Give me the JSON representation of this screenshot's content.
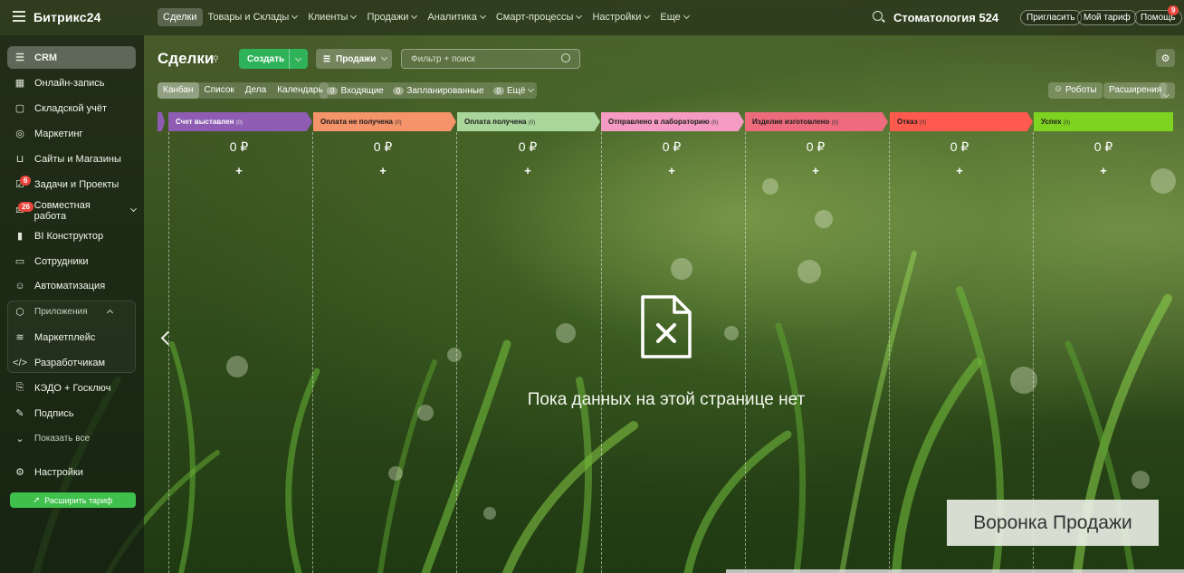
{
  "app": {
    "logo": "Битрикс24",
    "company": "Стоматология 524"
  },
  "topnav": {
    "items": [
      {
        "label": "Сделки",
        "active": true,
        "caret": false
      },
      {
        "label": "Товары и Склады",
        "caret": true
      },
      {
        "label": "Клиенты",
        "caret": true
      },
      {
        "label": "Продажи",
        "caret": true
      },
      {
        "label": "Аналитика",
        "caret": true
      },
      {
        "label": "Смарт-процессы",
        "caret": true
      },
      {
        "label": "Настройки",
        "caret": true
      },
      {
        "label": "Еще",
        "caret": true
      }
    ],
    "invite": "Пригласить",
    "tariff": "Мой тариф",
    "help": "Помощь",
    "help_badge": "9"
  },
  "sidebar": {
    "items": [
      {
        "label": "CRM",
        "icon": "filter-icon"
      },
      {
        "label": "Онлайн-запись",
        "icon": "calendar-icon"
      },
      {
        "label": "Складской учёт",
        "icon": "box-icon"
      },
      {
        "label": "Маркетинг",
        "icon": "target-icon"
      },
      {
        "label": "Сайты и Магазины",
        "icon": "cart-icon"
      },
      {
        "label": "Задачи и Проекты",
        "icon": "tasks-icon",
        "badge": "6"
      },
      {
        "label": "Совместная работа",
        "icon": "chat-icon",
        "badge": "26"
      },
      {
        "label": "BI Конструктор",
        "icon": "chart-icon"
      },
      {
        "label": "Сотрудники",
        "icon": "id-card-icon"
      },
      {
        "label": "Автоматизация",
        "icon": "robot-icon"
      },
      {
        "label": "Приложения",
        "icon": "cube-icon"
      },
      {
        "label": "Маркетплейс",
        "icon": "market-icon"
      },
      {
        "label": "Разработчикам",
        "icon": "code-icon"
      },
      {
        "label": "КЭДО + Госключ",
        "icon": "doc-icon"
      },
      {
        "label": "Подпись",
        "icon": "pen-icon"
      },
      {
        "label": "Показать все",
        "icon": "chevron-down-icon"
      },
      {
        "label": "Настройки",
        "icon": "gear-icon"
      }
    ],
    "upgrade": "Расширить тариф"
  },
  "page": {
    "title": "Сделки",
    "create": "Создать",
    "pipeline": "Продажи",
    "filter_placeholder": "Фильтр + поиск",
    "views": [
      "Канбан",
      "Список",
      "Дела",
      "Календарь"
    ],
    "counters": [
      {
        "n": "0",
        "label": "Входящие"
      },
      {
        "n": "0",
        "label": "Запланированные"
      },
      {
        "n": "0",
        "label": "Ещё"
      }
    ],
    "robots": "Роботы",
    "extensions": "Расширения"
  },
  "kanban": {
    "stages": [
      {
        "name": "Счет выставлен",
        "count": "(0)",
        "sum": "0 ₽",
        "color": "#8e5db3",
        "light": true
      },
      {
        "name": "Оплата не получена",
        "count": "(0)",
        "sum": "0 ₽",
        "color": "#f5936a"
      },
      {
        "name": "Оплата получена",
        "count": "(0)",
        "sum": "0 ₽",
        "color": "#a9d79b"
      },
      {
        "name": "Отправлено в лабораторию",
        "count": "(0)",
        "sum": "0 ₽",
        "color": "#f59bc3"
      },
      {
        "name": "Изделие изготовлено",
        "count": "(0)",
        "sum": "0 ₽",
        "color": "#ee6b7e"
      },
      {
        "name": "Отказ",
        "count": "(0)",
        "sum": "0 ₽",
        "color": "#ff5a4d"
      },
      {
        "name": "Успех",
        "count": "(0)",
        "sum": "0 ₽",
        "color": "#7ed321"
      }
    ],
    "plus": "+",
    "empty_text": "Пока данных на этой странице нет"
  },
  "watermark": "Воронка Продажи"
}
